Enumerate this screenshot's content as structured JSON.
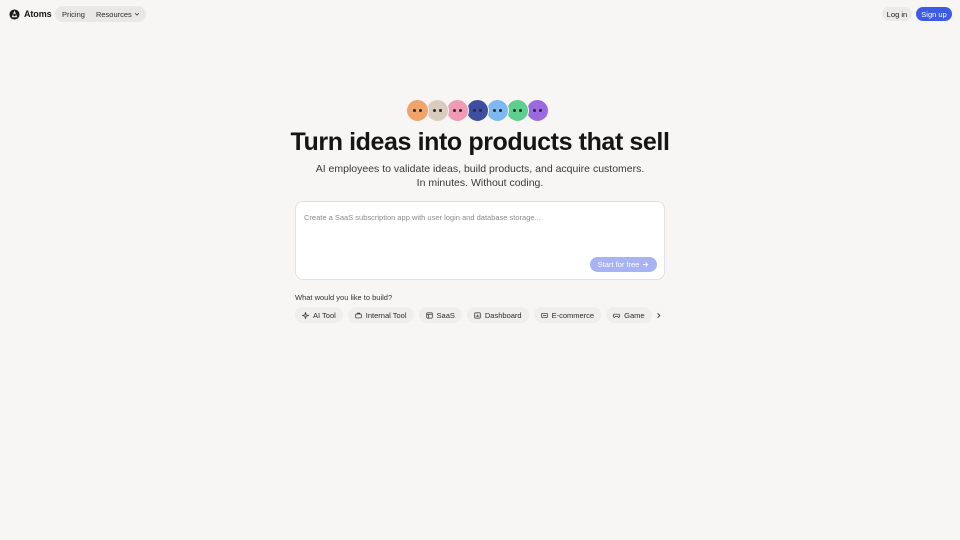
{
  "nav": {
    "brand": "Atoms",
    "links": [
      {
        "label": "Pricing"
      },
      {
        "label": "Resources"
      }
    ],
    "login_label": "Log in",
    "signup_label": "Sign up"
  },
  "hero": {
    "avatars": [
      {
        "name": "orange-character-avatar",
        "color": "#f0a36b"
      },
      {
        "name": "beige-character-avatar",
        "color": "#d9cbbd"
      },
      {
        "name": "pink-character-avatar",
        "color": "#f19ab5"
      },
      {
        "name": "navy-character-avatar",
        "color": "#3f4fa0"
      },
      {
        "name": "blue-character-avatar",
        "color": "#7db8ee"
      },
      {
        "name": "green-character-avatar",
        "color": "#5fcf8f"
      },
      {
        "name": "purple-character-avatar",
        "color": "#9b6ae0"
      }
    ],
    "title": "Turn ideas into products that sell",
    "subtitle_line1": "AI employees to validate ideas, build products, and acquire customers.",
    "subtitle_line2": "In minutes. Without coding."
  },
  "prompt": {
    "placeholder": "Create a SaaS subscription app with user login and database storage...",
    "value": "",
    "start_label": "Start for free"
  },
  "build": {
    "label": "What would you like to build?",
    "chips": [
      {
        "label": "AI Tool",
        "icon": "sparkle-icon"
      },
      {
        "label": "Internal Tool",
        "icon": "briefcase-icon"
      },
      {
        "label": "SaaS",
        "icon": "app-window-icon"
      },
      {
        "label": "Dashboard",
        "icon": "chart-panel-icon"
      },
      {
        "label": "E-commerce",
        "icon": "cart-card-icon"
      },
      {
        "label": "Game",
        "icon": "gamepad-icon"
      },
      {
        "label": "",
        "icon": "monitor-icon"
      }
    ]
  },
  "colors": {
    "accent": "#3d5ce6",
    "accent_disabled": "#a7b3f2",
    "background": "#f7f6f5"
  }
}
